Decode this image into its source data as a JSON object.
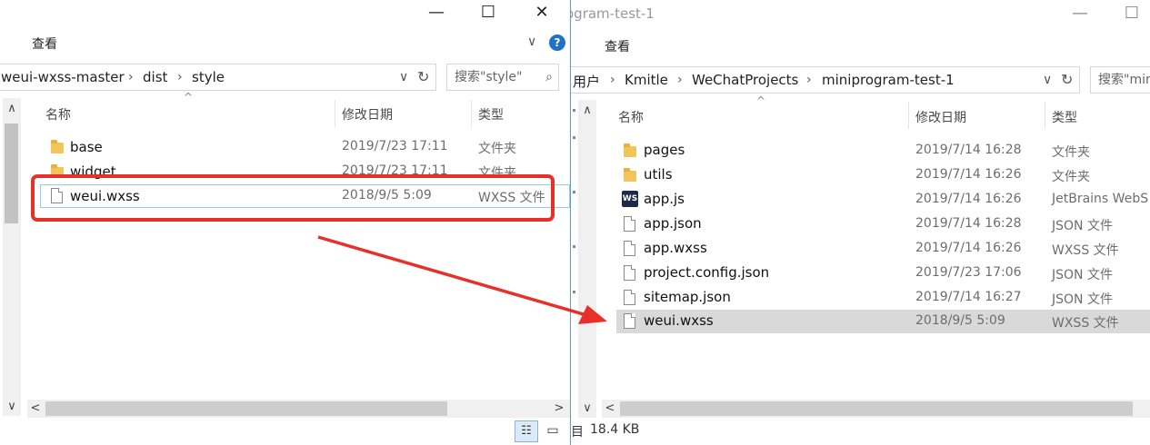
{
  "left": {
    "title_buttons": {
      "minimize": "—",
      "maximize": "☐",
      "close": "✕"
    },
    "menu": {
      "view": "查看"
    },
    "address": {
      "crumbs": [
        "weui-wxss-master",
        "dist",
        "style"
      ],
      "sep": "›"
    },
    "search": {
      "placeholder": "搜索\"style\""
    },
    "columns": {
      "name": "名称",
      "date": "修改日期",
      "type": "类型"
    },
    "rows": [
      {
        "name": "base",
        "date": "2019/7/23 17:11",
        "type": "文件夹",
        "icon": "folder-icon"
      },
      {
        "name": "widget",
        "date": "2019/7/23 17:11",
        "type": "文件夹",
        "icon": "folder-icon"
      },
      {
        "name": "weui.wxss",
        "date": "2018/9/5 5:09",
        "type": "WXSS 文件",
        "icon": "file-icon"
      }
    ]
  },
  "right": {
    "title": "ogram-test-1",
    "menu": {
      "view": "查看"
    },
    "address": {
      "crumbs": [
        "用户",
        "Kmitle",
        "WeChatProjects",
        "miniprogram-test-1"
      ],
      "sep": "›"
    },
    "search": {
      "placeholder": "搜索\"mini"
    },
    "columns": {
      "name": "名称",
      "date": "修改日期",
      "type": "类型"
    },
    "rows": [
      {
        "name": "pages",
        "date": "2019/7/14 16:28",
        "type": "文件夹",
        "icon": "folder-icon"
      },
      {
        "name": "utils",
        "date": "2019/7/14 16:26",
        "type": "文件夹",
        "icon": "folder-icon"
      },
      {
        "name": "app.js",
        "date": "2019/7/14 16:26",
        "type": "JetBrains WebS",
        "icon": "webstorm-icon"
      },
      {
        "name": "app.json",
        "date": "2019/7/14 16:28",
        "type": "JSON 文件",
        "icon": "file-icon"
      },
      {
        "name": "app.wxss",
        "date": "2019/7/14 16:26",
        "type": "WXSS 文件",
        "icon": "file-icon"
      },
      {
        "name": "project.config.json",
        "date": "2019/7/23 17:06",
        "type": "JSON 文件",
        "icon": "file-icon"
      },
      {
        "name": "sitemap.json",
        "date": "2019/7/14 16:27",
        "type": "JSON 文件",
        "icon": "file-icon"
      },
      {
        "name": "weui.wxss",
        "date": "2018/9/5 5:09",
        "type": "WXSS 文件",
        "icon": "file-icon"
      }
    ],
    "status": {
      "size": "18.4 KB",
      "fragment": "目"
    }
  },
  "annotation": {
    "highlight_color": "#e8302a",
    "arrow_color": "#e8302a"
  },
  "ws_icon_text": "WS"
}
